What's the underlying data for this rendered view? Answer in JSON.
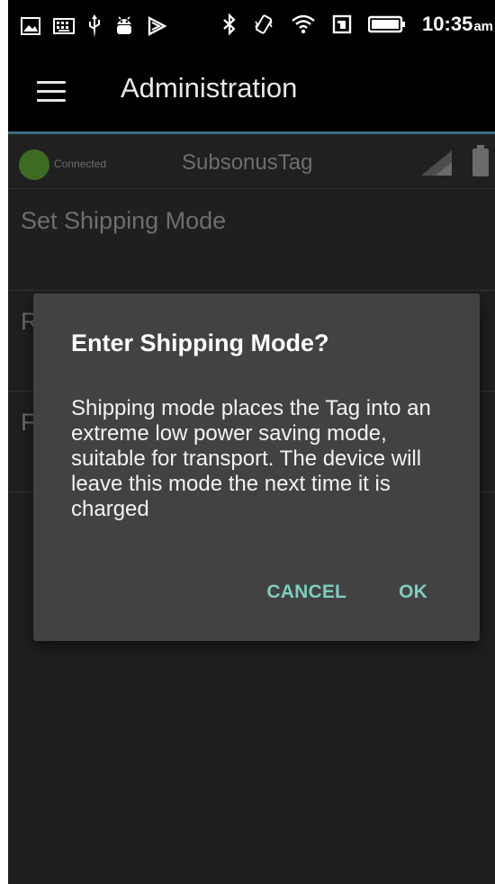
{
  "status_bar": {
    "time": "10:35",
    "ampm": "am",
    "icons_left": [
      "image-icon",
      "keyboard-icon",
      "usb-icon",
      "android-debug-icon",
      "play-store-icon"
    ],
    "icons_right": [
      "bluetooth-icon",
      "vibrate-icon",
      "wifi-icon",
      "nfc-icon",
      "battery-icon"
    ]
  },
  "app_bar": {
    "title": "Administration",
    "menu_icon": "hamburger-menu-icon"
  },
  "connection": {
    "status_label": "Connected",
    "device_name": "SubsonusTag",
    "status_color": "#3c6b22"
  },
  "menu": {
    "items": [
      {
        "label": "Set Shipping Mode"
      },
      {
        "label": "R"
      },
      {
        "label": "F"
      }
    ]
  },
  "dialog": {
    "title": "Enter Shipping Mode?",
    "body": "Shipping mode places the Tag into an extreme low power saving mode, suitable for transport. The device will leave this mode the next time it is charged",
    "cancel_label": "CANCEL",
    "ok_label": "OK",
    "accent_color": "#7ecdbf"
  }
}
